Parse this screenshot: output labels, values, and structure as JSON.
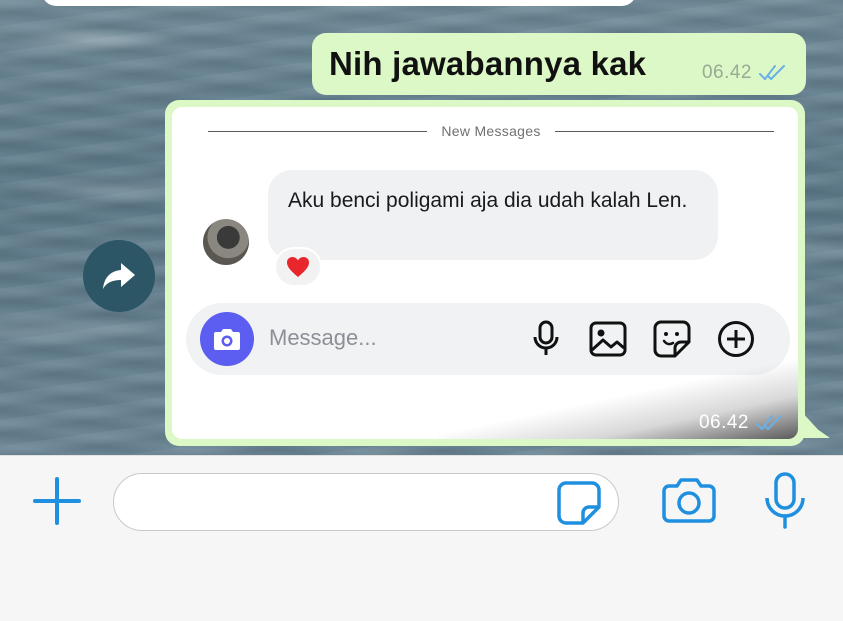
{
  "chat": {
    "outgoing_messages": [
      {
        "text": "Nih jawabannya kak",
        "time": "06.42",
        "status_icon": "double-check-icon"
      },
      {
        "time": "06.42",
        "status_icon": "double-check-icon"
      }
    ],
    "screenshot": {
      "divider_label": "New Messages",
      "received_message": "Aku benci poligami aja dia udah kalah Len.",
      "reaction": "❤️",
      "composer_placeholder": "Message...",
      "composer_icons": [
        "camera-icon",
        "microphone-icon",
        "gallery-icon",
        "sticker-icon",
        "add-circle-icon"
      ]
    },
    "share_icon": "forward-arrow-icon"
  },
  "input_bar": {
    "icons": [
      "plus-icon",
      "sticker-icon",
      "camera-icon",
      "microphone-icon"
    ],
    "text_value": ""
  },
  "colors": {
    "outgoing_bubble": "#dcf8c6",
    "accent_blue": "#1f8fe0",
    "composer_camera": "#5b5ef0",
    "read_ticks": "#6ab0e6"
  }
}
